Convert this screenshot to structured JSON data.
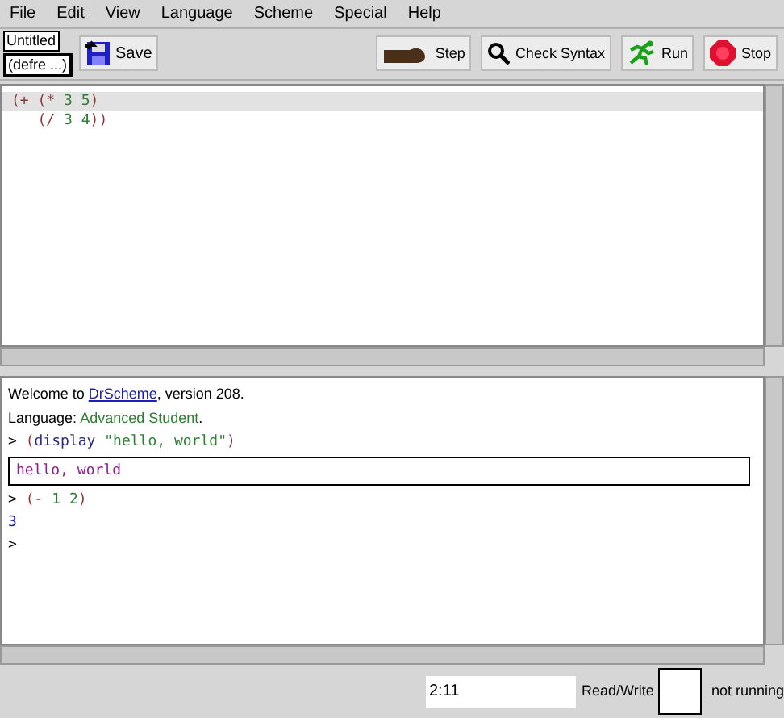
{
  "menu": [
    "File",
    "Edit",
    "View",
    "Language",
    "Scheme",
    "Special",
    "Help"
  ],
  "toolbar": {
    "file_name": "Untitled",
    "definitions_menu": "(defre ...)",
    "save": "Save",
    "buttons": [
      {
        "kind": "step",
        "label": "Step"
      },
      {
        "kind": "check",
        "label": "Check Syntax"
      },
      {
        "kind": "run",
        "label": "Run"
      },
      {
        "kind": "stop",
        "label": "Stop"
      }
    ]
  },
  "editor": {
    "lines": [
      {
        "highlighted": true,
        "tokens": [
          {
            "kind": "paren",
            "text": "(+ "
          },
          {
            "kind": "paren",
            "text": "(* "
          },
          {
            "kind": "number",
            "text": "3 5"
          },
          {
            "kind": "paren",
            "text": ")"
          }
        ]
      },
      {
        "highlighted": false,
        "tokens": [
          {
            "kind": "paren",
            "text": "   (/ "
          },
          {
            "kind": "number",
            "text": "3 4"
          },
          {
            "kind": "paren",
            "text": "))"
          }
        ]
      }
    ]
  },
  "interactions": {
    "lines": [
      {
        "kind": "text",
        "segments": [
          {
            "kind": "plain",
            "text": "Welcome to "
          },
          {
            "kind": "link",
            "text": "DrScheme"
          },
          {
            "kind": "plain",
            "text": ", version 208."
          }
        ]
      },
      {
        "kind": "text",
        "segments": [
          {
            "kind": "plain",
            "text": "Language: "
          },
          {
            "kind": "language",
            "text": "Advanced Student"
          },
          {
            "kind": "plain",
            "text": "."
          }
        ]
      },
      {
        "kind": "input",
        "segments": [
          {
            "kind": "prompt",
            "text": "> "
          },
          {
            "kind": "paren",
            "text": "("
          },
          {
            "kind": "symbol",
            "text": "display "
          },
          {
            "kind": "string",
            "text": "\"hello, world\""
          },
          {
            "kind": "paren",
            "text": ")"
          }
        ]
      },
      {
        "kind": "output",
        "text": "hello, world"
      },
      {
        "kind": "input",
        "segments": [
          {
            "kind": "prompt",
            "text": "> "
          },
          {
            "kind": "paren",
            "text": "(- "
          },
          {
            "kind": "number",
            "text": "1 2"
          },
          {
            "kind": "paren",
            "text": ")"
          }
        ]
      },
      {
        "kind": "result",
        "segments": [
          {
            "kind": "result",
            "text": "3"
          }
        ]
      },
      {
        "kind": "input",
        "segments": [
          {
            "kind": "prompt",
            "text": ">"
          }
        ]
      }
    ]
  },
  "status_bar": {
    "position": "2:11",
    "mode": "Read/Write",
    "running": "not running"
  }
}
